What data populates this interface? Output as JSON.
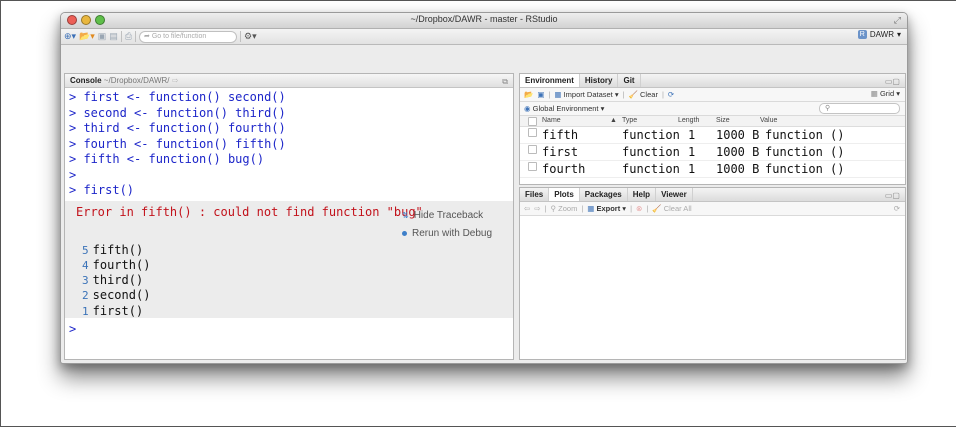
{
  "window": {
    "title": "~/Dropbox/DAWR - master - RStudio",
    "user": "DAWR"
  },
  "toolbar": {
    "goto_placeholder": "Go to file/function"
  },
  "console": {
    "label": "Console",
    "path": "~/Dropbox/DAWR/",
    "code_lines": [
      "> first <- function() second()",
      "> second <- function() third()",
      "> third <- function() fourth()",
      "> fourth <- function() fifth()",
      "> fifth <- function() bug()",
      ">",
      "> first()"
    ],
    "error": "Error in fifth() : could not find function \"bug\"",
    "hide_traceback": "Hide Traceback",
    "rerun_debug": "Rerun with Debug",
    "traceback": [
      {
        "n": "5",
        "call": "fifth()"
      },
      {
        "n": "4",
        "call": "fourth()"
      },
      {
        "n": "3",
        "call": "third()"
      },
      {
        "n": "2",
        "call": "second()"
      },
      {
        "n": "1",
        "call": "first()"
      }
    ],
    "prompt": ">"
  },
  "environment": {
    "tabs": [
      "Environment",
      "History",
      "Git"
    ],
    "import_label": "Import Dataset",
    "clear_label": "Clear",
    "grid_label": "Grid",
    "scope_label": "Global Environment",
    "columns": [
      "Name",
      "Type",
      "Length",
      "Size",
      "Value"
    ],
    "rows": [
      {
        "name": "fifth",
        "type": "function",
        "length": "1",
        "size": "1000 B",
        "value": "function ()"
      },
      {
        "name": "first",
        "type": "function",
        "length": "1",
        "size": "1000 B",
        "value": "function ()"
      },
      {
        "name": "fourth",
        "type": "function",
        "length": "1",
        "size": "1000 B",
        "value": "function ()"
      }
    ]
  },
  "files": {
    "tabs": [
      "Files",
      "Plots",
      "Packages",
      "Help",
      "Viewer"
    ],
    "zoom_label": "Zoom",
    "export_label": "Export",
    "clear_all_label": "Clear All"
  }
}
